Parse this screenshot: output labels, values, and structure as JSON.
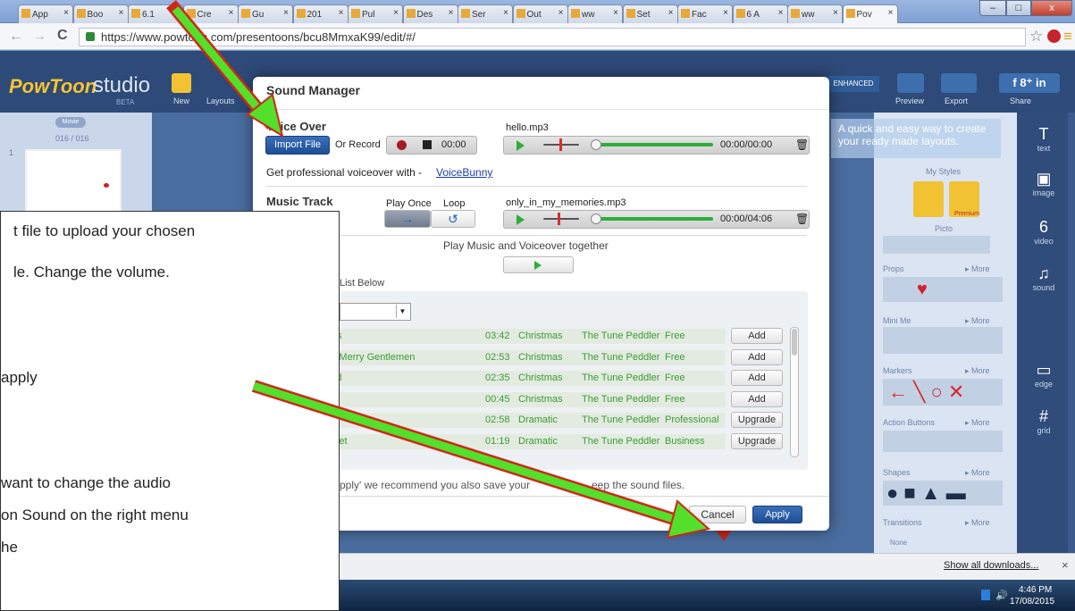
{
  "browser": {
    "tabs": [
      {
        "label": "App",
        "close": "×"
      },
      {
        "label": "Boo",
        "close": "×"
      },
      {
        "label": "6.1",
        "close": "×"
      },
      {
        "label": "Cre",
        "close": "×"
      },
      {
        "label": "Gu",
        "close": "×"
      },
      {
        "label": "201",
        "close": "×"
      },
      {
        "label": "Pul",
        "close": "×"
      },
      {
        "label": "Des",
        "close": "×"
      },
      {
        "label": "Ser",
        "close": "×"
      },
      {
        "label": "Out",
        "close": "×"
      },
      {
        "label": "ww",
        "close": "×"
      },
      {
        "label": "Set",
        "close": "×"
      },
      {
        "label": "Fac",
        "close": "×"
      },
      {
        "label": "6 A",
        "close": "×"
      },
      {
        "label": "ww",
        "close": "×"
      },
      {
        "label": "Pov",
        "close": "×"
      }
    ],
    "url": "https://www.powtoon.com/presentoons/bcu8MmxaK99/edit/#/",
    "back": "←",
    "forward": "→",
    "reload": "C",
    "star": "☆",
    "menu": "≡",
    "window_min": "–",
    "window_max": "□",
    "window_close": "x"
  },
  "powtoon": {
    "logo": "PowToon",
    "logo_suffix": "studio",
    "beta": "BETA",
    "toolbar_new": "New",
    "toolbar_layouts": "Layouts",
    "enhanced": "ENHANCED",
    "preview": "Preview",
    "export": "Export",
    "share": "Share",
    "movie_label": "Movie",
    "slide_count": "016 / 016",
    "slide_number": "1",
    "hint_text": "A quick and easy way to create your ready made layouts.",
    "my_styles": "My Styles",
    "picto": "Picto",
    "props": "Props",
    "mini_me": "Mini Me",
    "markers": "Markers",
    "action_buttons": "Action Buttons",
    "shapes": "Shapes",
    "transitions": "Transitions",
    "more": "▸ More",
    "none": "None",
    "premium": "Premium",
    "right_menu": [
      {
        "icon": "T",
        "label": "text"
      },
      {
        "icon": "▣",
        "label": "image"
      },
      {
        "icon": "6",
        "label": "video"
      },
      {
        "icon": "♫",
        "label": "sound"
      },
      {
        "icon": "▭",
        "label": "edge"
      },
      {
        "icon": "#",
        "label": "grid"
      }
    ]
  },
  "dialog": {
    "title": "Sound Manager",
    "voice_over": {
      "heading": "Voice Over",
      "import_label": "Import File",
      "or_record": "Or Record",
      "time": "00:00",
      "file": "hello.mp3",
      "duration": "00:00/00:00",
      "voicebunny_text": "Get professional voiceover with - ",
      "voicebunny_link": "VoiceBunny"
    },
    "music_track": {
      "heading": "Music Track",
      "play_once": "Play Once",
      "loop": "Loop",
      "file": "only_in_my_memories.mp3",
      "duration": "00:00/04:06"
    },
    "play_together": "Play Music and Voiceover together",
    "list_below": "List Below",
    "tracks": [
      {
        "title": "Halls",
        "time": "03:42",
        "genre": "Christmas",
        "artist": "The Tune Peddler",
        "license": "Free",
        "action": "Add"
      },
      {
        "title": "t Ye Merry Gentlemen",
        "time": "02:53",
        "genre": "Christmas",
        "artist": "The Tune Peddler",
        "license": "Free",
        "action": "Add"
      },
      {
        "title": "ound",
        "time": "02:35",
        "genre": "Christmas",
        "artist": "The Tune Peddler",
        "license": "Free",
        "action": "Add"
      },
      {
        "title": "llin",
        "time": "00:45",
        "genre": "Christmas",
        "artist": "The Tune Peddler",
        "license": "Free",
        "action": "Add"
      },
      {
        "title": "",
        "time": "02:58",
        "genre": "Dramatic",
        "artist": "The Tune Peddler",
        "license": "Professional",
        "action": "Upgrade"
      },
      {
        "title": "nd Yet",
        "time": "01:19",
        "genre": "Dramatic",
        "artist": "The Tune Peddler",
        "license": "Business",
        "action": "Upgrade"
      }
    ],
    "footer_note": "pply' we recommend you also save your",
    "footer_note2": "eep the sound files.",
    "cancel": "Cancel",
    "apply": "Apply"
  },
  "callout": {
    "lines": [
      "t file to upload your chosen",
      "le. Change the volume.",
      "apply",
      "want to change the audio",
      "on Sound on the right menu",
      "he"
    ]
  },
  "download_bar": {
    "show_all": "Show all downloads...",
    "close": "×"
  },
  "taskbar": {
    "time": "4:46 PM",
    "date": "17/08/2015"
  },
  "colors": {
    "arrow_fill": "#52e02a",
    "arrow_outline": "#d0261b",
    "track_green": "#2eae3a",
    "row_text_green": "#3c9b33",
    "apply_blue": "#1e4f96"
  }
}
